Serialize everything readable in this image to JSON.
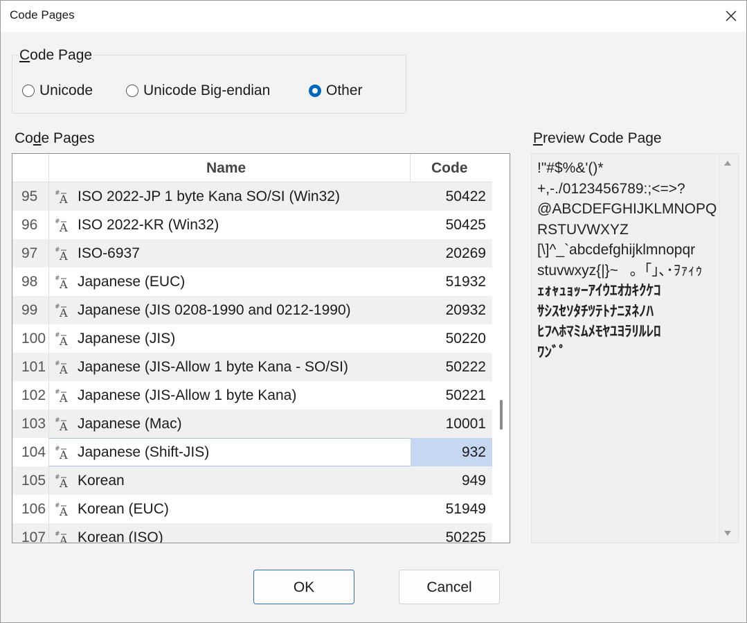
{
  "window": {
    "title": "Code Pages"
  },
  "code_page_group": {
    "legend": "Code Page",
    "options": [
      {
        "label": "Unicode",
        "checked": false
      },
      {
        "label": "Unicode Big-endian",
        "checked": false
      },
      {
        "label": "Other",
        "checked": true
      }
    ]
  },
  "code_pages_label": "Code Pages",
  "table": {
    "columns": {
      "name": "Name",
      "code": "Code"
    },
    "rows": [
      {
        "num": "95",
        "name": "ISO 2022-JP 1 byte Kana SO/SI (Win32)",
        "code": "50422"
      },
      {
        "num": "96",
        "name": "ISO 2022-KR (Win32)",
        "code": "50425"
      },
      {
        "num": "97",
        "name": "ISO-6937",
        "code": "20269"
      },
      {
        "num": "98",
        "name": "Japanese (EUC)",
        "code": "51932"
      },
      {
        "num": "99",
        "name": "Japanese (JIS 0208-1990 and 0212-1990)",
        "code": "20932"
      },
      {
        "num": "100",
        "name": "Japanese (JIS)",
        "code": "50220"
      },
      {
        "num": "101",
        "name": "Japanese (JIS-Allow 1 byte Kana - SO/SI)",
        "code": "50222"
      },
      {
        "num": "102",
        "name": "Japanese (JIS-Allow 1 byte Kana)",
        "code": "50221"
      },
      {
        "num": "103",
        "name": "Japanese (Mac)",
        "code": "10001"
      },
      {
        "num": "104",
        "name": "Japanese (Shift-JIS)",
        "code": "932"
      },
      {
        "num": "105",
        "name": "Korean",
        "code": "949"
      },
      {
        "num": "106",
        "name": "Korean (EUC)",
        "code": "51949"
      },
      {
        "num": "107",
        "name": "Korean (ISO)",
        "code": "50225"
      }
    ],
    "selected_num": "104"
  },
  "preview": {
    "label": "Preview Code Page",
    "lines": [
      "!\"#$%&'()*",
      "+,-./0123456789:;<=>?",
      "@ABCDEFGHIJKLMNOPQ",
      "RSTUVWXYZ",
      "[\\]^_`abcdefghijklmnopqr",
      "stuvwxyz{|}~。｢｣､･ｦｧｨｩ",
      "ｪｫｬｭｮｯｰｱｲｳｴｵｶｷｸｹｺ",
      "ｻｼｽｾｿﾀﾁﾂﾃﾄﾅﾆﾇﾈﾉﾊ",
      "ﾋﾌﾍﾎﾏﾐﾑﾒﾓﾔﾕﾖﾗﾘﾙﾚﾛ",
      "ﾜﾝﾞﾟ   "
    ]
  },
  "buttons": {
    "ok": "OK",
    "cancel": "Cancel"
  },
  "colors": {
    "accent": "#0067c0",
    "selection": "#c6d7f2"
  }
}
